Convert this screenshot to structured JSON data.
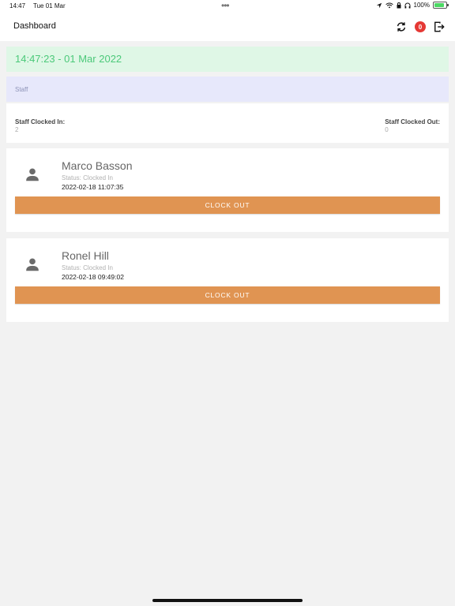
{
  "statusbar": {
    "time": "14:47",
    "date": "Tue 01 Mar",
    "battery_pct": "100%"
  },
  "navbar": {
    "title": "Dashboard",
    "notification_count": "0"
  },
  "clock": {
    "text": "14:47:23 - 01 Mar 2022"
  },
  "staff_section": {
    "title": "Staff"
  },
  "summary": {
    "clocked_in_label": "Staff Clocked In:",
    "clocked_in_value": "2",
    "clocked_out_label": "Staff Clocked Out:",
    "clocked_out_value": "0"
  },
  "staff": [
    {
      "name": "Marco Basson",
      "status": "Status: Clocked In",
      "timestamp": "2022-02-18 11:07:35",
      "button_label": "CLOCK OUT"
    },
    {
      "name": "Ronel Hill",
      "status": "Status: Clocked In",
      "timestamp": "2022-02-18 09:49:02",
      "button_label": "CLOCK OUT"
    }
  ],
  "colors": {
    "accent": "#e09452",
    "clock_banner": "#dff7e6",
    "clock_text": "#4cc97a",
    "staff_header": "#e7e8fb",
    "badge": "#e53935"
  },
  "icons": {
    "refresh": "refresh-icon",
    "logout": "logout-icon",
    "avatar": "person-icon"
  }
}
